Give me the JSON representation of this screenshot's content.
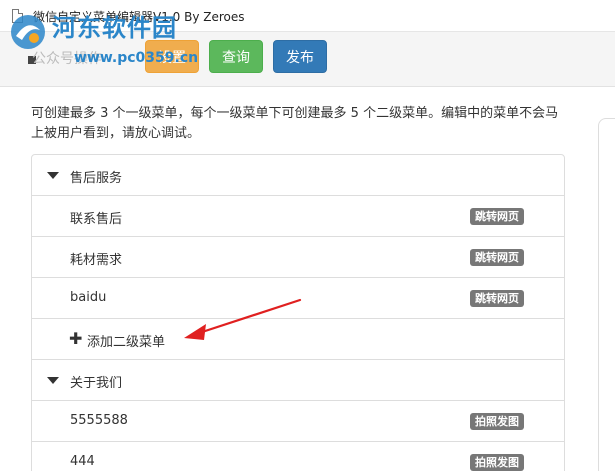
{
  "window": {
    "title": "微信自定义菜单编辑器V1.0 By Zeroes",
    "icon": "document-icon"
  },
  "watermark": {
    "name": "河东软件园",
    "url": "www.pc0359.cn"
  },
  "toolbar": {
    "account_label": "公众号操作",
    "settings_label": "设置",
    "query_label": "查询",
    "publish_label": "发布"
  },
  "intro": "可创建最多 3 个一级菜单，每个一级菜单下可创建最多 5 个二级菜单。编辑中的菜单不会马上被用户看到，请放心调试。",
  "menus": [
    {
      "name": "售后服务",
      "items": [
        {
          "name": "联系售后",
          "type": "跳转网页"
        },
        {
          "name": "耗材需求",
          "type": "跳转网页"
        },
        {
          "name": "baidu",
          "type": "跳转网页"
        }
      ],
      "add_label": "添加二级菜单"
    },
    {
      "name": "关于我们",
      "items": [
        {
          "name": "5555588",
          "type": "拍照发图"
        },
        {
          "name": "444",
          "type": "拍照发图"
        }
      ]
    }
  ],
  "colors": {
    "settings": "#f0ad4e",
    "query": "#5cb85c",
    "publish": "#337ab7",
    "tag": "#777777",
    "annotation_arrow": "#e02020",
    "watermark": "#2b86c9"
  }
}
